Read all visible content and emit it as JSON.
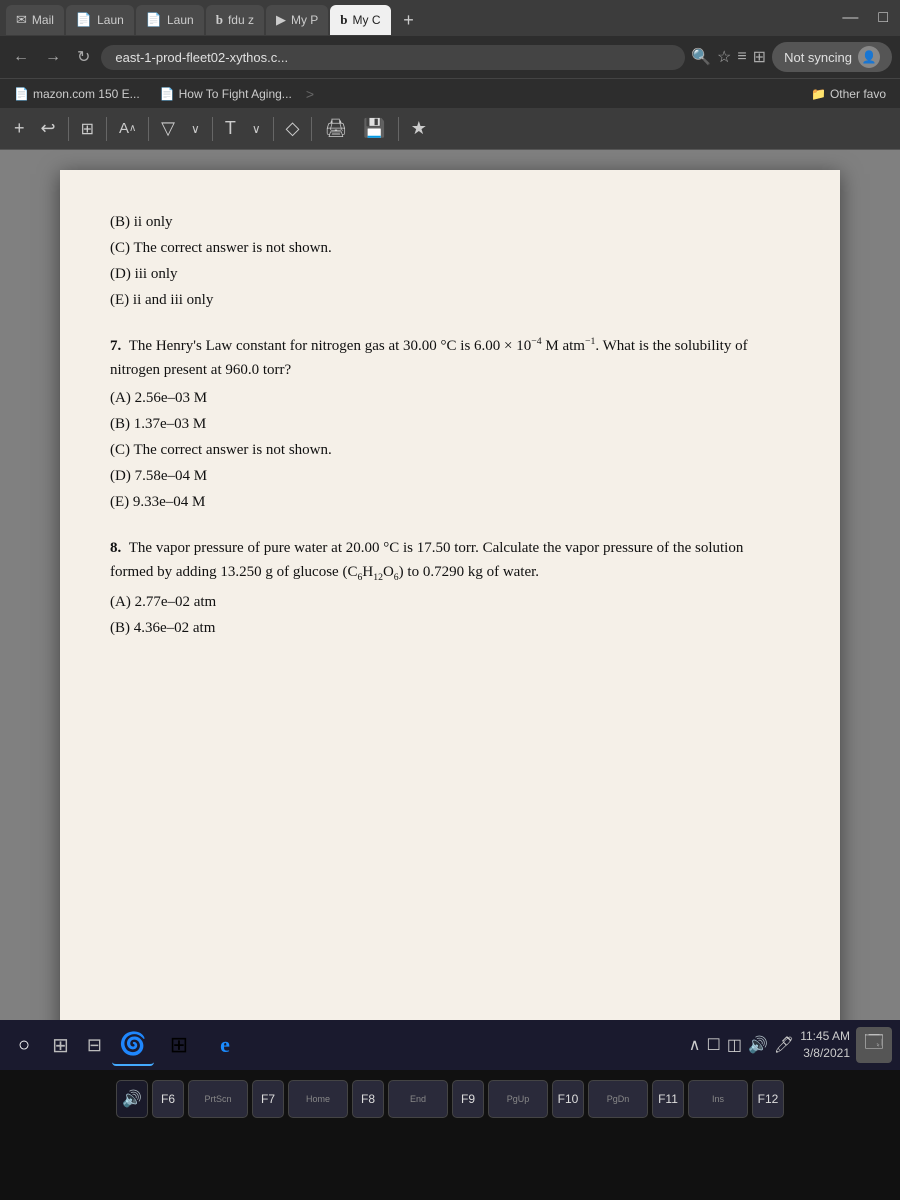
{
  "browser": {
    "tabs": [
      {
        "id": "mail",
        "label": "Mail",
        "icon": "✉",
        "active": false
      },
      {
        "id": "laun1",
        "label": "Laun",
        "icon": "📄",
        "active": false
      },
      {
        "id": "laun2",
        "label": "Laun",
        "icon": "📄",
        "active": false
      },
      {
        "id": "fduz",
        "label": "fdu z",
        "icon": "b",
        "active": false
      },
      {
        "id": "myp",
        "label": "My P",
        "icon": "▶",
        "active": false
      },
      {
        "id": "myc1",
        "label": "My C",
        "icon": "b",
        "active": true
      },
      {
        "id": "plus",
        "label": "+",
        "icon": "",
        "active": false
      }
    ],
    "address": "east-1-prod-fleet02-xythos.c...",
    "sync_label": "Not syncing",
    "bookmarks": [
      {
        "label": "mazon.com 150 E...",
        "icon": "📄"
      },
      {
        "label": "How To Fight Aging...",
        "icon": "📄"
      },
      {
        "label": "Other favo",
        "icon": "📁"
      }
    ]
  },
  "pdf_toolbar": {
    "tools": [
      "+",
      "↩",
      "|",
      "⊞",
      "|",
      "A^",
      "|",
      "▽",
      "▽",
      "|",
      "T",
      "▽",
      "|",
      "◇",
      "|",
      "🖨",
      "💾",
      "|",
      "★"
    ]
  },
  "pdf": {
    "content": {
      "q6_choices": [
        "(B)  ii only",
        "(C)  The correct answer is not shown.",
        "(D)  iii only",
        "(E)  ii and iii only"
      ],
      "q7_number": "7.",
      "q7_text": "The Henry's Law constant for nitrogen gas at 30.00 °C is 6.00 × 10⁻⁴ M atm⁻¹. What is the solubility of nitrogen present at 960.0 torr?",
      "q7_choices": [
        "(A)  2.56e–03 M",
        "(B)  1.37e–03 M",
        "(C)  The correct answer is not shown.",
        "(D)  7.58e–04 M",
        "(E)  9.33e–04 M"
      ],
      "q8_number": "8.",
      "q8_text": "The vapor pressure of pure water at 20.00 °C is 17.50 torr. Calculate the vapor pressure of the solution formed by adding 13.250 g of glucose (C₆H₁₂O₆) to 0.7290 kg of water.",
      "q8_choices": [
        "(A)  2.77e–02 atm",
        "(B)  4.36e–02 atm"
      ]
    }
  },
  "taskbar": {
    "time": "11:45 AM",
    "date": "3/8/2021",
    "apps": [
      {
        "id": "start",
        "icon": "○"
      },
      {
        "id": "search",
        "icon": "⊞"
      },
      {
        "id": "widgets",
        "icon": "⊟"
      },
      {
        "id": "edge",
        "icon": "🌀"
      },
      {
        "id": "windows",
        "icon": "⊞"
      },
      {
        "id": "ie",
        "icon": "e"
      }
    ],
    "sys_icons": [
      "^",
      "☐",
      "◫",
      "🔊",
      "🖊"
    ]
  },
  "keyboard": {
    "rows": [
      [
        {
          "fn": "",
          "main": "🔊",
          "id": "speaker"
        },
        {
          "fn": "F6",
          "main": ""
        },
        {
          "fn": "PrtScn",
          "main": "",
          "wide": true
        },
        {
          "fn": "F7",
          "main": ""
        },
        {
          "fn": "Home",
          "main": "",
          "wide": true
        },
        {
          "fn": "F8",
          "main": ""
        },
        {
          "fn": "End",
          "main": "",
          "wide": true
        },
        {
          "fn": "F9",
          "main": ""
        },
        {
          "fn": "PgUp",
          "main": "",
          "wide": true
        },
        {
          "fn": "F10",
          "main": ""
        },
        {
          "fn": "PgDn",
          "main": "",
          "wide": true
        },
        {
          "fn": "F11",
          "main": ""
        },
        {
          "fn": "Ins",
          "main": "",
          "wide": true
        },
        {
          "fn": "F12",
          "main": ""
        }
      ]
    ]
  }
}
